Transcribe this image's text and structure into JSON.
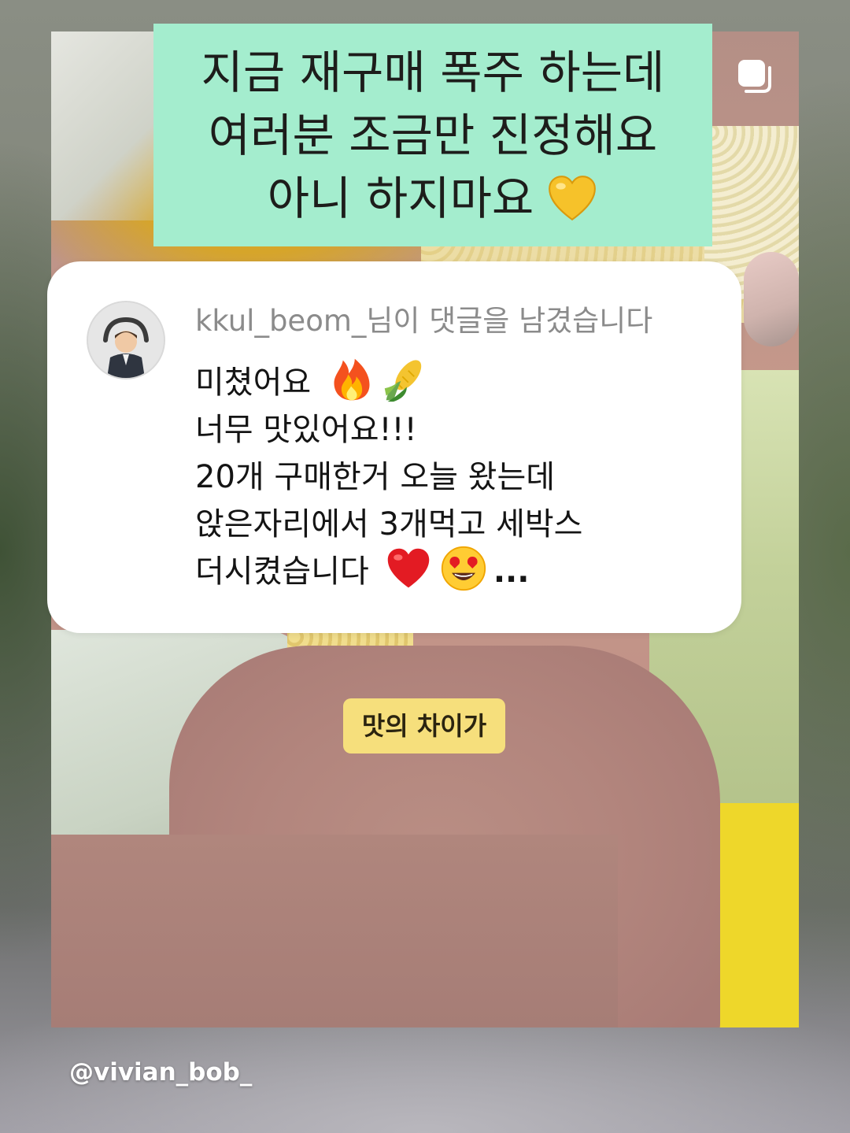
{
  "header_caption": {
    "lines": [
      "지금 재구매 폭주 하는데",
      "여러분 조금만 진정해요",
      "아니 하지마요"
    ],
    "line3_emoji": "yellow-heart-icon"
  },
  "multi_image_icon": "multiple-images-icon",
  "comment": {
    "avatar": "avatar",
    "username_line": "kkul_beom_님이 댓글을 남겼습니다",
    "lines": [
      "미쳤어요",
      "너무 맛있어요!!!",
      "20개 구매한거 오늘 왔는데",
      "앉은자리에서 3개먹고 세박스",
      "더시켰습니다"
    ],
    "line1_emojis": [
      "fire-icon",
      "corn-icon"
    ],
    "line5_emojis": [
      "red-heart-icon",
      "heart-eyes-icon"
    ],
    "ellipsis": "..."
  },
  "subtitle": "맛의 차이가",
  "watermark": "@vivian_bob_",
  "colors": {
    "caption_bg": "#a4edce",
    "card_bg": "#ffffff",
    "subtitle_bg": "#f6df7c"
  }
}
